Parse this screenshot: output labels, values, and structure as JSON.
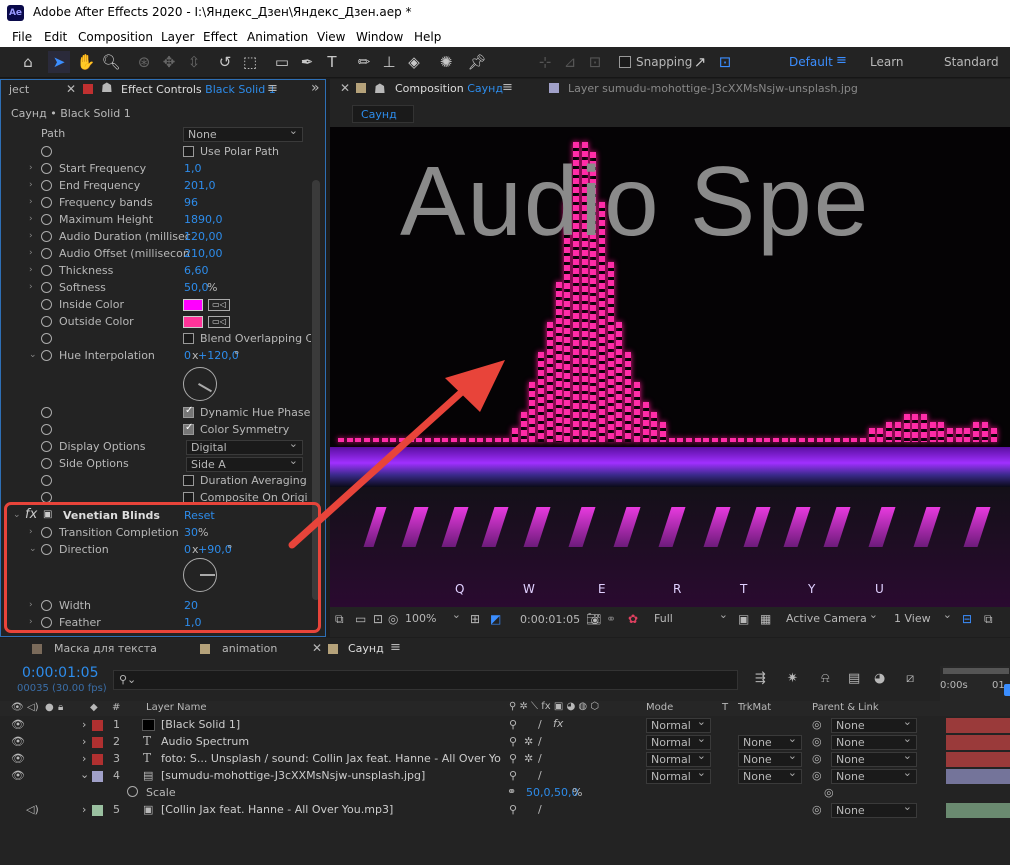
{
  "window": {
    "title": "Adobe After Effects 2020 - I:\\Яндекс_Дзен\\Яндекс_Дзен.aep *",
    "icon_text": "Ae"
  },
  "menu": [
    "File",
    "Edit",
    "Composition",
    "Layer",
    "Effect",
    "Animation",
    "View",
    "Window",
    "Help"
  ],
  "toolbar": {
    "snapping": "Snapping",
    "workspaces": [
      "Default",
      "Learn",
      "Standard"
    ]
  },
  "effect_panel": {
    "left_tab": "ject",
    "tab_label": "Effect Controls",
    "tab_target": "Black Solid 1",
    "breadcrumb": "Саунд • Black Solid 1",
    "path_label": "Path",
    "path_value": "None",
    "use_polar": "Use Polar Path",
    "props": [
      {
        "name": "Start Frequency",
        "value": "1,0"
      },
      {
        "name": "End Frequency",
        "value": "201,0"
      },
      {
        "name": "Frequency bands",
        "value": "96"
      },
      {
        "name": "Maximum Height",
        "value": "1890,0"
      },
      {
        "name": "Audio Duration (millisec",
        "value": "120,00"
      },
      {
        "name": "Audio Offset (millisecon",
        "value": "210,00"
      },
      {
        "name": "Thickness",
        "value": "6,60"
      },
      {
        "name": "Softness",
        "value": "50,0",
        "unit": "%"
      }
    ],
    "inside_color": {
      "label": "Inside Color",
      "color": "#ff00ff"
    },
    "outside_color": {
      "label": "Outside Color",
      "color": "#ff3399"
    },
    "blend_overlapping": "Blend Overlapping C",
    "hue_interp": {
      "label": "Hue Interpolation",
      "rev": "0",
      "x": "x",
      "angle": "+120,0",
      "deg": "°"
    },
    "dynamic_hue": "Dynamic Hue Phase",
    "color_symmetry": "Color Symmetry",
    "display_options": {
      "label": "Display Options",
      "value": "Digital"
    },
    "side_options": {
      "label": "Side Options",
      "value": "Side A"
    },
    "duration_avg": "Duration Averaging",
    "composite": "Composite On Origi",
    "venetian": {
      "fx": "fx",
      "name": "Venetian Blinds",
      "reset": "Reset",
      "transition": {
        "label": "Transition Completion",
        "value": "30",
        "unit": "%"
      },
      "direction": {
        "label": "Direction",
        "rev": "0",
        "x": "x",
        "angle": "+90,0",
        "deg": "°"
      },
      "width": {
        "label": "Width",
        "value": "20"
      },
      "feather": {
        "label": "Feather",
        "value": "1,0"
      }
    }
  },
  "comp_panel": {
    "tab_label": "Composition",
    "tab_target": "Саунд",
    "layer_tab": "Layer sumudu-mohottige-J3cXXMsNsjw-unsplash.jpg",
    "sub_tab": "Саунд",
    "overlay_text": "Audio Spe",
    "keys": [
      "Q",
      "W",
      "E",
      "R",
      "T",
      "Y",
      "U"
    ],
    "zoom": "100%",
    "timecode": "0:00:01:05",
    "resolution": "Full",
    "camera": "Active Camera",
    "views": "1 View"
  },
  "timeline": {
    "tabs": [
      "Маска для текста",
      "animation",
      "Саунд"
    ],
    "tab_colors": [
      "#7a6a5a",
      "#b5a27a",
      "#b5a27a"
    ],
    "timecode": "0:00:01:05",
    "frames": "00035 (30.00 fps)",
    "search_placeholder": "",
    "columns": {
      "layer_name": "Layer Name",
      "mode": "Mode",
      "t": "T",
      "trkmat": "TrkMat",
      "parent": "Parent & Link"
    },
    "ruler": [
      "0:00s",
      "01"
    ],
    "layers": [
      {
        "num": "1",
        "name": "[Black Solid 1]",
        "label": "#b03030",
        "mode": "Normal",
        "trkmat": "",
        "parent": "None",
        "type": "solid"
      },
      {
        "num": "2",
        "name": "Audio Spectrum",
        "label": "#b03030",
        "mode": "Normal",
        "trkmat": "None",
        "parent": "None",
        "type": "text"
      },
      {
        "num": "3",
        "name": "foto: S... Unsplash / sound: Collin Jax feat. Hanne - All Over You",
        "label": "#b03030",
        "mode": "Normal",
        "trkmat": "None",
        "parent": "None",
        "type": "text"
      },
      {
        "num": "4",
        "name": "[sumudu-mohottige-J3cXXMsNsjw-unsplash.jpg]",
        "label": "#a0a0c8",
        "mode": "Normal",
        "trkmat": "None",
        "parent": "None",
        "type": "image"
      },
      {
        "num": "5",
        "name": "[Collin Jax feat. Hanne - All Over You.mp3]",
        "label": "#9ac0a0",
        "mode": "",
        "trkmat": "",
        "parent": "None",
        "type": "audio"
      }
    ],
    "scale": {
      "label": "Scale",
      "value": "50,0,50,0",
      "unit": "%"
    }
  }
}
